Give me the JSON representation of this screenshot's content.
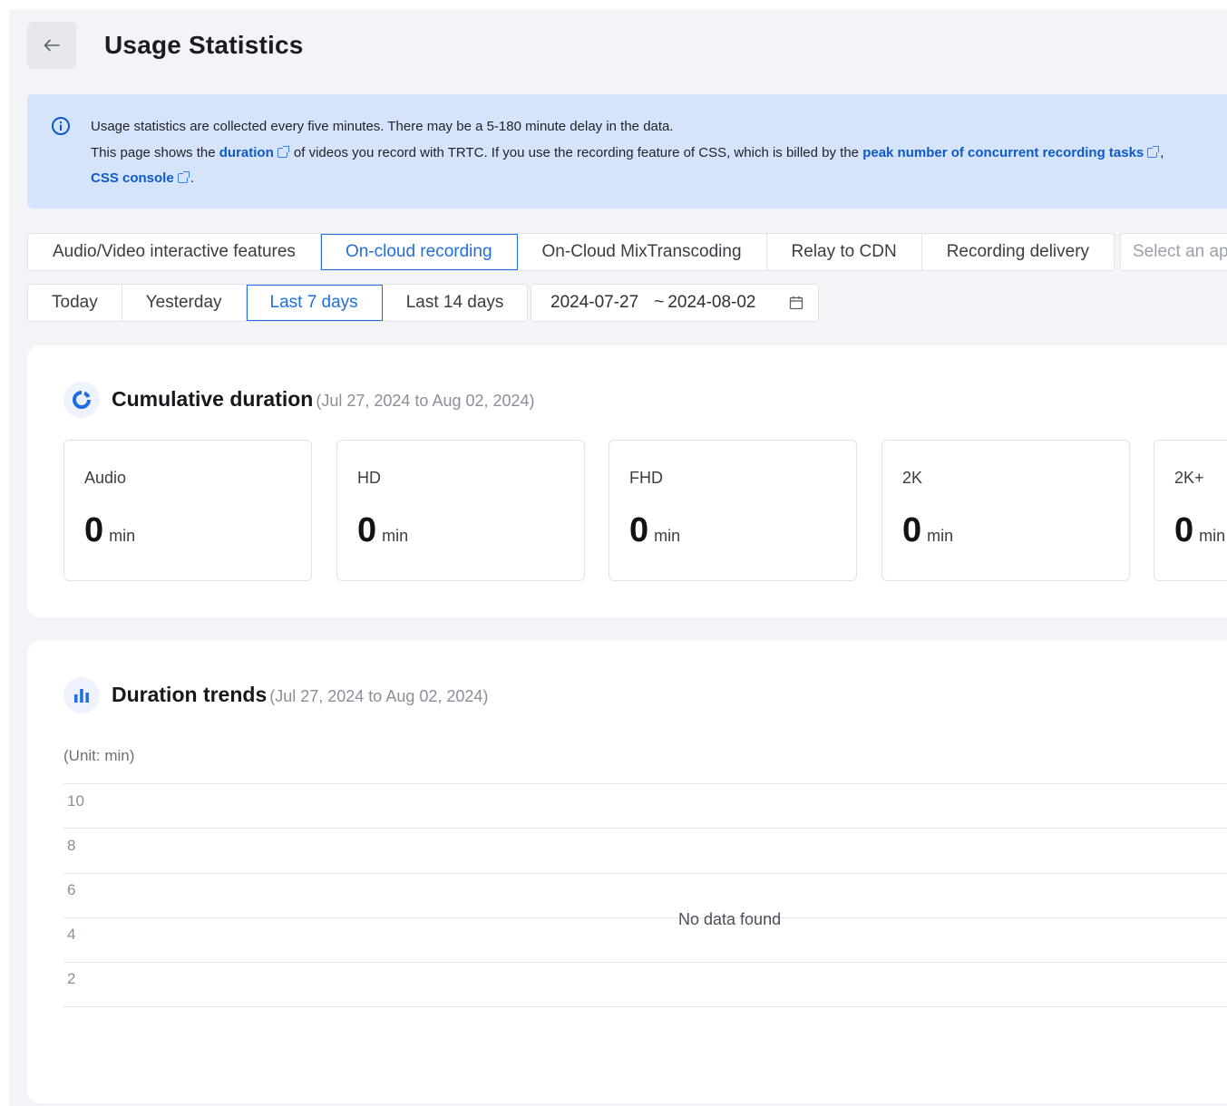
{
  "header": {
    "title": "Usage Statistics",
    "back_icon": "arrow-left-icon"
  },
  "notice": {
    "line1": "Usage statistics are collected every five minutes. There may be a 5-180 minute delay in the data.",
    "line2_part1": "This page shows the",
    "line2_link1": "duration",
    "line2_part2": "of videos you record with TRTC. If you use the recording feature of CSS, which is billed by the",
    "line2_link2": "peak number of concurrent recording tasks",
    "line2_part3": ",",
    "line3_link": "CSS console",
    "line3_end": "."
  },
  "feature_tabs": [
    {
      "label": "Audio/Video interactive features",
      "active": false
    },
    {
      "label": "On-cloud recording",
      "active": true
    },
    {
      "label": "On-Cloud MixTranscoding",
      "active": false
    },
    {
      "label": "Relay to CDN",
      "active": false
    },
    {
      "label": "Recording delivery",
      "active": false
    }
  ],
  "app_select": {
    "placeholder": "Select an ap"
  },
  "range_tabs": [
    {
      "label": "Today",
      "active": false
    },
    {
      "label": "Yesterday",
      "active": false
    },
    {
      "label": "Last 7 days",
      "active": true
    },
    {
      "label": "Last 14 days",
      "active": false
    }
  ],
  "date_range": {
    "start": "2024-07-27",
    "separator": "~",
    "end": "2024-08-02"
  },
  "cumulative": {
    "title": "Cumulative duration",
    "subtitle": "(Jul 27, 2024 to Aug 02, 2024)",
    "stats": [
      {
        "label": "Audio",
        "value": "0",
        "unit": "min"
      },
      {
        "label": "HD",
        "value": "0",
        "unit": "min"
      },
      {
        "label": "FHD",
        "value": "0",
        "unit": "min"
      },
      {
        "label": "2K",
        "value": "0",
        "unit": "min"
      },
      {
        "label": "2K+",
        "value": "0",
        "unit": "min"
      }
    ]
  },
  "trends": {
    "title": "Duration trends",
    "subtitle": "(Jul 27, 2024 to Aug 02, 2024)",
    "unit_label": "(Unit: min)",
    "empty_text": "No data found"
  },
  "chart_data": {
    "type": "line",
    "ylabel": "(Unit: min)",
    "yticks": [
      "10",
      "8",
      "6",
      "4",
      "2"
    ],
    "ylim": [
      0,
      10
    ],
    "series": [],
    "grid": true
  },
  "colors": {
    "accent": "#1f6fe0",
    "notice_bg": "#d6e4fb",
    "link": "#0e5ac9"
  }
}
